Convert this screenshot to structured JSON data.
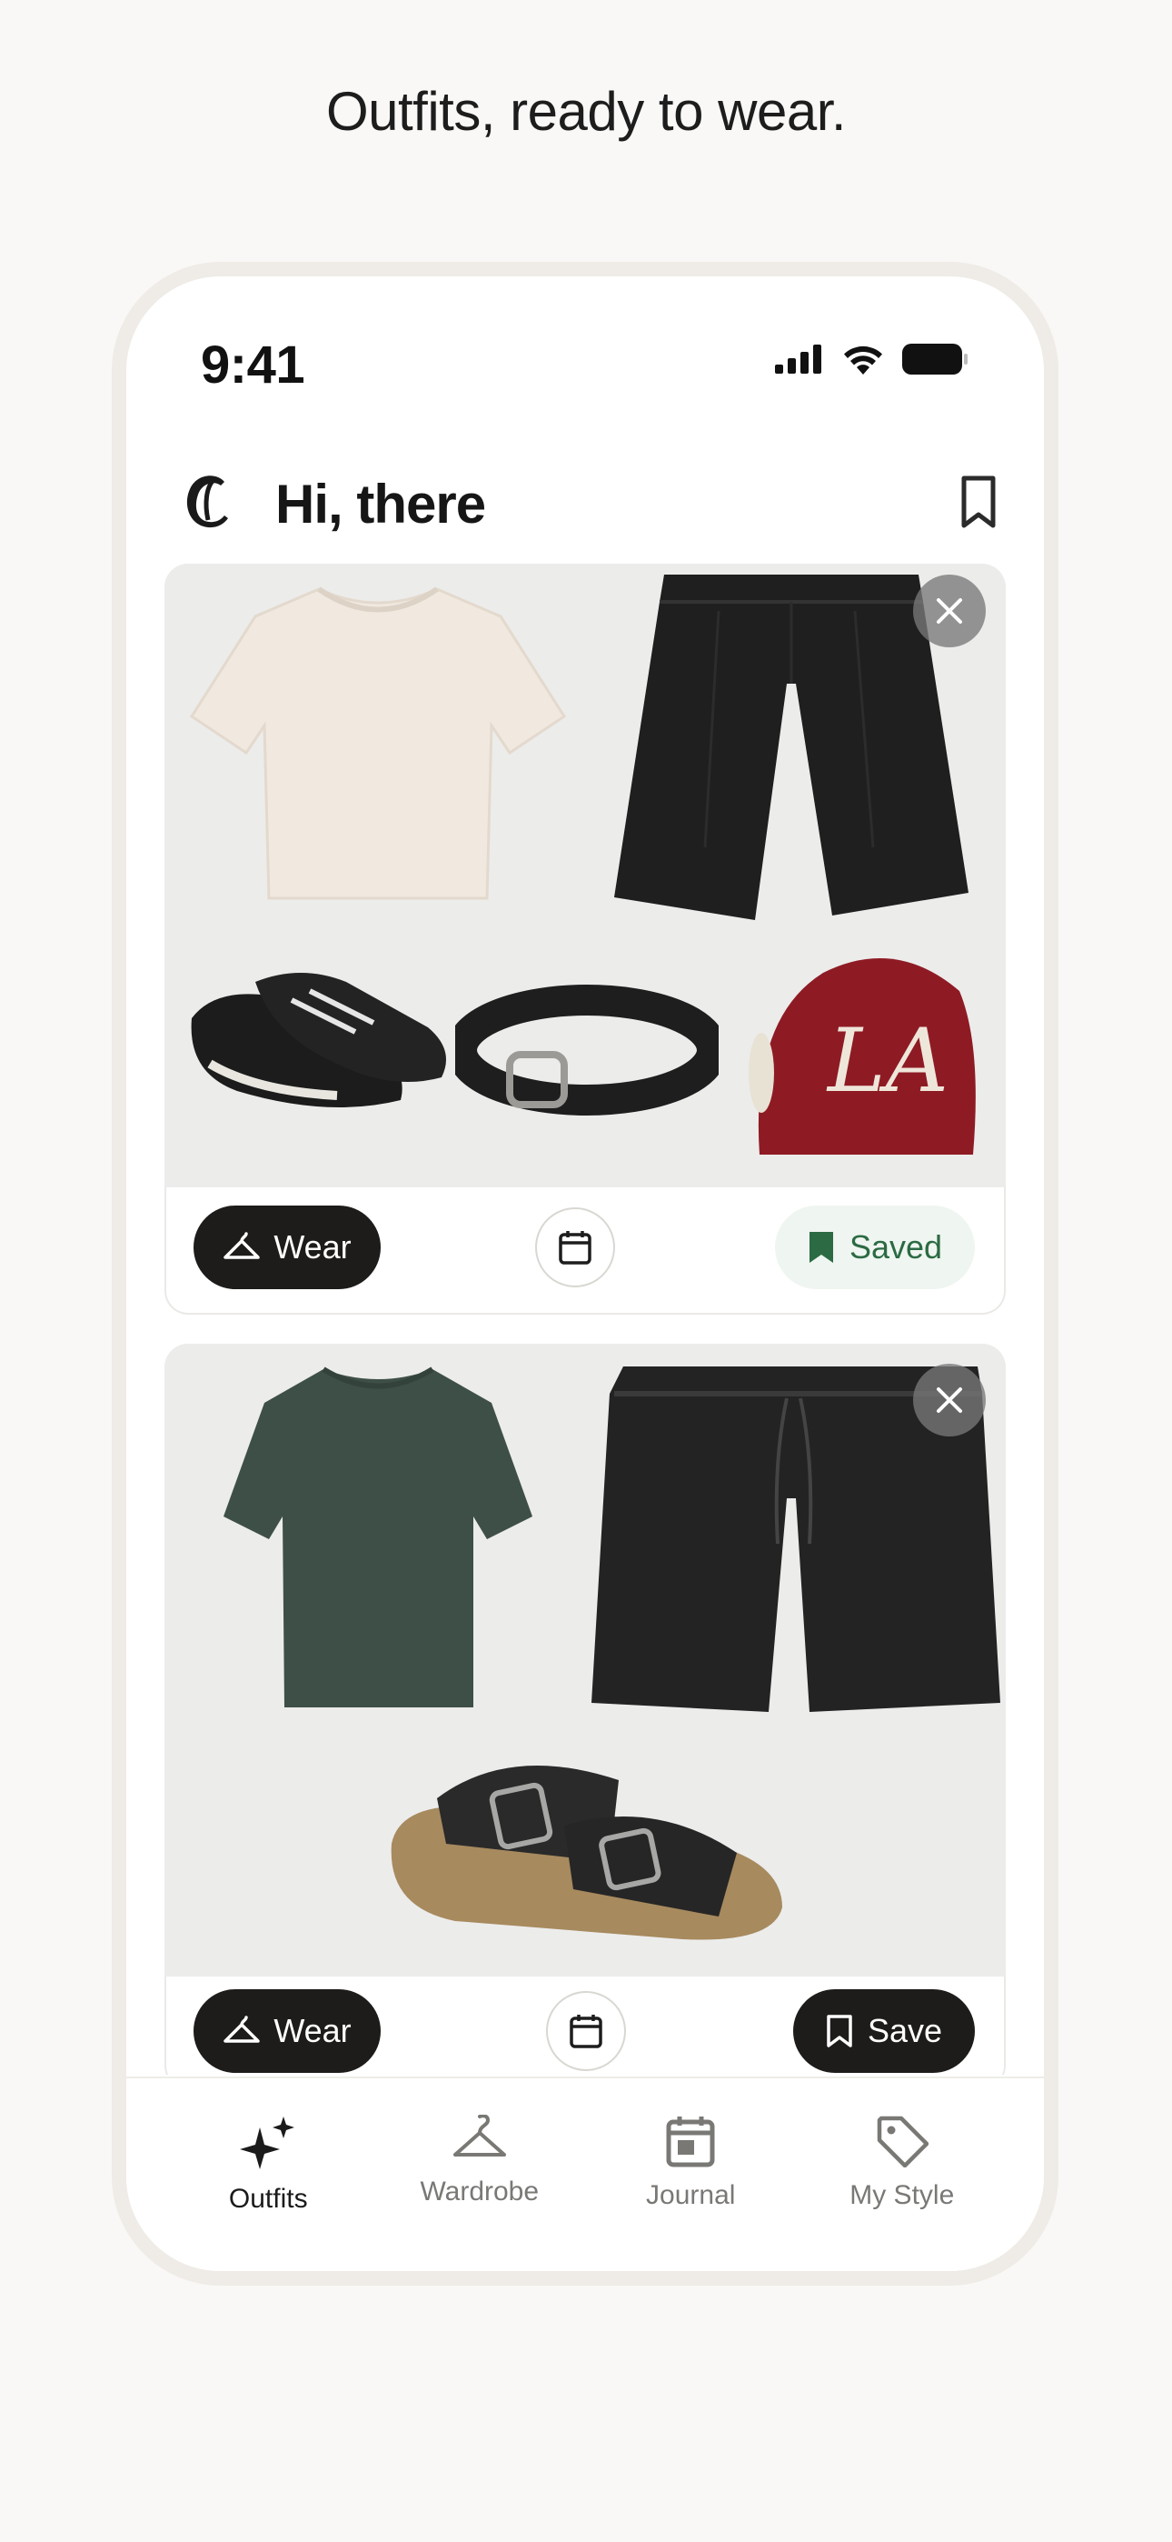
{
  "headline": "Outfits, ready to wear.",
  "status_bar": {
    "time": "9:41"
  },
  "header": {
    "greeting": "Hi, there"
  },
  "outfits": [
    {
      "items": [
        "cream-tshirt",
        "black-pleated-shorts",
        "black-white-sneakers",
        "black-braided-belt",
        "red-la-cap"
      ],
      "wear_label": "Wear",
      "save_label": "Saved",
      "saved": true
    },
    {
      "items": [
        "green-tshirt",
        "black-drawstring-shorts",
        "black-suede-sandals"
      ],
      "wear_label": "Wear",
      "save_label": "Save",
      "saved": false
    }
  ],
  "tabs": [
    {
      "label": "Outfits",
      "icon": "sparkle-icon",
      "active": true
    },
    {
      "label": "Wardrobe",
      "icon": "hanger-icon",
      "active": false
    },
    {
      "label": "Journal",
      "icon": "calendar-icon",
      "active": false
    },
    {
      "label": "My Style",
      "icon": "tag-icon",
      "active": false
    }
  ],
  "colors": {
    "background": "#f9f8f6",
    "accent_dark": "#1d1c1a",
    "saved_green": "#2b6a43",
    "saved_bg": "#eff5f0"
  }
}
